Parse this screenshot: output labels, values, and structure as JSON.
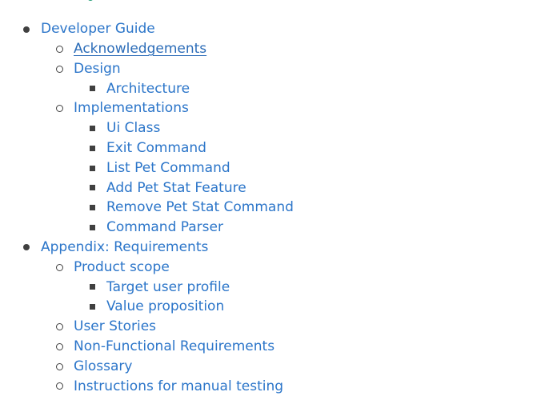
{
  "toc": {
    "items": [
      {
        "label": "Developer Guide",
        "level": 1,
        "name": "toc-developer-guide"
      },
      {
        "label": "Acknowledgements",
        "level": 2,
        "name": "toc-acknowledgements",
        "active": true
      },
      {
        "label": "Design",
        "level": 2,
        "name": "toc-design"
      },
      {
        "label": "Architecture",
        "level": 3,
        "name": "toc-architecture"
      },
      {
        "label": "Implementations",
        "level": 2,
        "name": "toc-implementations"
      },
      {
        "label": "Ui Class",
        "level": 3,
        "name": "toc-ui-class"
      },
      {
        "label": "Exit Command",
        "level": 3,
        "name": "toc-exit-command"
      },
      {
        "label": "List Pet Command",
        "level": 3,
        "name": "toc-list-pet-command"
      },
      {
        "label": "Add Pet Stat Feature",
        "level": 3,
        "name": "toc-add-pet-stat-feature"
      },
      {
        "label": "Remove Pet Stat Command",
        "level": 3,
        "name": "toc-remove-pet-stat-command"
      },
      {
        "label": "Command Parser",
        "level": 3,
        "name": "toc-command-parser"
      },
      {
        "label": "Appendix: Requirements",
        "level": 1,
        "name": "toc-appendix-requirements"
      },
      {
        "label": "Product scope",
        "level": 2,
        "name": "toc-product-scope"
      },
      {
        "label": "Target user profile",
        "level": 3,
        "name": "toc-target-user-profile"
      },
      {
        "label": "Value proposition",
        "level": 3,
        "name": "toc-value-proposition"
      },
      {
        "label": "User Stories",
        "level": 2,
        "name": "toc-user-stories"
      },
      {
        "label": "Non-Functional Requirements",
        "level": 2,
        "name": "toc-non-functional-requirements"
      },
      {
        "label": "Glossary",
        "level": 2,
        "name": "toc-glossary"
      },
      {
        "label": "Instructions for manual testing",
        "level": 2,
        "name": "toc-instructions-manual-testing"
      }
    ]
  },
  "colors": {
    "link": "#2b75c9",
    "bullet": "#404040",
    "heading_accent": "#1e9c74"
  }
}
